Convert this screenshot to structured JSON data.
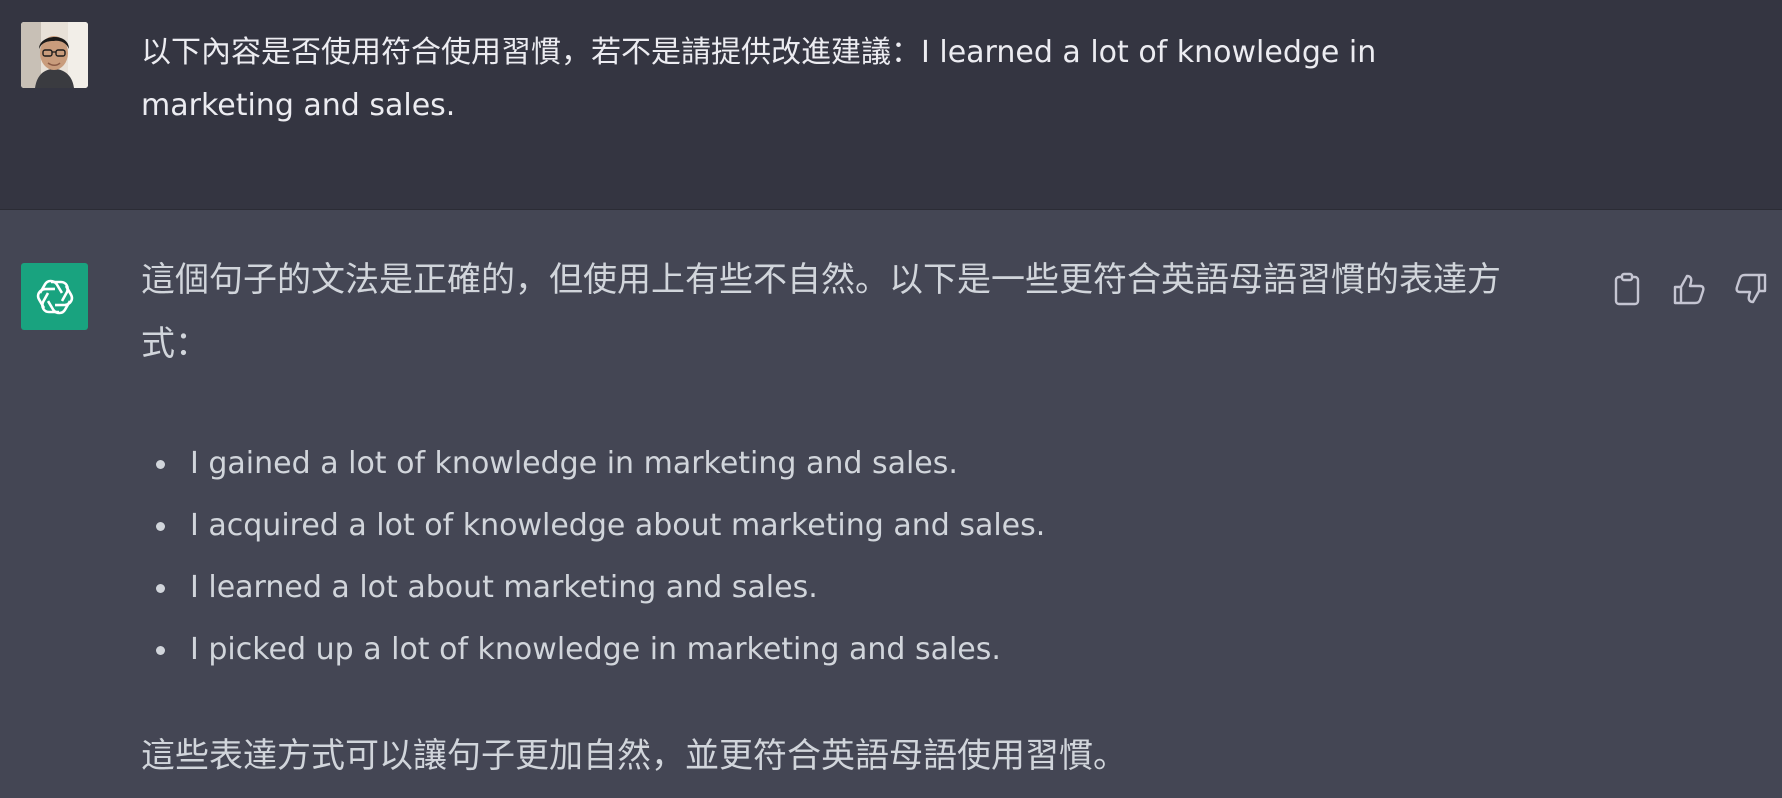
{
  "user_message": {
    "lines": [
      "以下內容是否使用符合使用習慣，若不是請提供改進建議：I learned a lot of knowledge in",
      "marketing and sales."
    ]
  },
  "assistant_message": {
    "intro_lines": [
      "這個句子的文法是正確的，但使用上有些不自然。以下是一些更符合英語母語習慣的表達方",
      "式："
    ],
    "suggestions": [
      "I gained a lot of knowledge in marketing and sales.",
      "I acquired a lot of knowledge about marketing and sales.",
      "I learned a lot about marketing and sales.",
      "I picked up a lot of knowledge in marketing and sales."
    ],
    "outro": "這些表達方式可以讓句子更加自然，並更符合英語母語使用習慣。"
  },
  "icons": {
    "user_avatar": "user-avatar",
    "assistant_avatar": "openai-logo-icon",
    "copy": "clipboard-icon",
    "like": "thumbs-up-icon",
    "dislike": "thumbs-down-icon"
  },
  "colors": {
    "user_bg": "#343541",
    "assistant_bg": "#444654",
    "assistant_avatar_bg": "#19a37f",
    "text": "#d1d5db"
  }
}
